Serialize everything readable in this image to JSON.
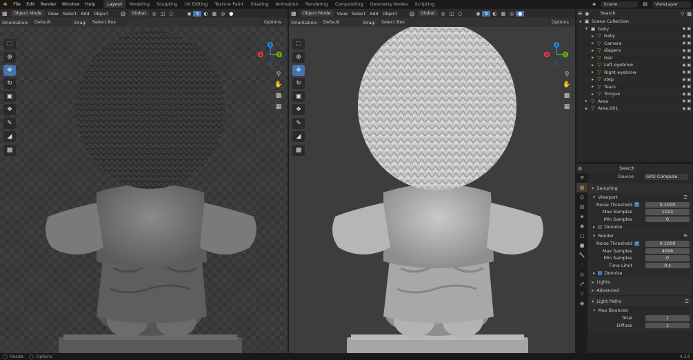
{
  "topbar": {
    "menu": [
      "File",
      "Edit",
      "Render",
      "Window",
      "Help"
    ],
    "workspaces": [
      "Layout",
      "Modeling",
      "Sculpting",
      "UV Editing",
      "Texture Paint",
      "Shading",
      "Animation",
      "Rendering",
      "Compositing",
      "Geometry Nodes",
      "Scripting"
    ],
    "active_workspace": "Layout",
    "scene": "Scene",
    "view_layer": "ViewLayer"
  },
  "viewport_left": {
    "mode": "Object Mode",
    "menus": [
      "View",
      "Select",
      "Add",
      "Object"
    ],
    "orientation_dd": "Global",
    "orientation_label": "Orientation:",
    "orientation_value": "Default",
    "drag_label": "Drag:",
    "drag_value": "Select Box",
    "options": "Options"
  },
  "viewport_right": {
    "mode": "Object Mode",
    "menus": [
      "View",
      "Select",
      "Add",
      "Object"
    ],
    "orientation_dd": "Global",
    "orientation_label": "Orientation:",
    "orientation_value": "Default",
    "drag_label": "Drag:",
    "drag_value": "Select Box",
    "options": "Options"
  },
  "gizmo": {
    "x": "X",
    "y": "Y",
    "z": "Z"
  },
  "outliner": {
    "search_placeholder": "Search",
    "rows": [
      {
        "label": "Scene Collection",
        "indent": 0
      },
      {
        "label": "baby",
        "indent": 1
      },
      {
        "label": "baby",
        "indent": 2
      },
      {
        "label": "Camera",
        "indent": 2
      },
      {
        "label": "diapers",
        "indent": 2
      },
      {
        "label": "Hair",
        "indent": 2
      },
      {
        "label": "Left eyebrow",
        "indent": 2
      },
      {
        "label": "Right eyebrow",
        "indent": 2
      },
      {
        "label": "step",
        "indent": 2
      },
      {
        "label": "Tears",
        "indent": 2
      },
      {
        "label": "Tongue",
        "indent": 2
      },
      {
        "label": "Area",
        "indent": 1
      },
      {
        "label": "Area.001",
        "indent": 1
      }
    ]
  },
  "properties": {
    "search_placeholder": "Search",
    "device_label": "Device",
    "device_value": "GPU Compute",
    "sampling": "Sampling",
    "viewport": "Viewport",
    "vp_noise_label": "Noise Threshold",
    "vp_noise_value": "0.1000",
    "vp_max_label": "Max Samples",
    "vp_max_value": "1024",
    "vp_min_label": "Min Samples",
    "vp_min_value": "0",
    "vp_denoise": "Denoise",
    "render": "Render",
    "r_noise_label": "Noise Threshold",
    "r_noise_value": "0.1000",
    "r_max_label": "Max Samples",
    "r_max_value": "4096",
    "r_min_label": "Min Samples",
    "r_min_value": "0",
    "r_time_label": "Time Limit",
    "r_time_value": "0 s",
    "r_denoise": "Denoise",
    "lights": "Lights",
    "advanced": "Advanced",
    "light_paths": "Light Paths",
    "max_bounces": "Max Bounces",
    "total_label": "Total",
    "total_value": "1",
    "diffuse_label": "Diffuse",
    "diffuse_value": "1"
  },
  "status": {
    "resize": "Resize",
    "options": "Options",
    "version": "4.3.0"
  }
}
